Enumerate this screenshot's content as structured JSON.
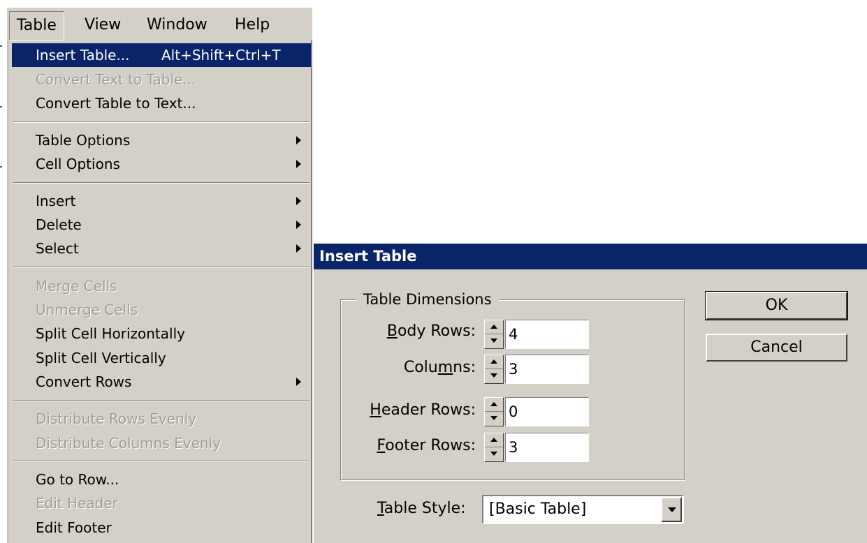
{
  "menubar": {
    "items": [
      {
        "label": "Table",
        "active": true
      },
      {
        "label": "View",
        "active": false
      },
      {
        "label": "Window",
        "active": false
      },
      {
        "label": "Help",
        "active": false
      }
    ]
  },
  "table_menu": {
    "insert_table": {
      "label": "Insert Table...",
      "shortcut": "Alt+Shift+Ctrl+T"
    },
    "convert_text_to_table": "Convert Text to Table...",
    "convert_table_to_text": "Convert Table to Text...",
    "table_options": "Table Options",
    "cell_options": "Cell Options",
    "insert": "Insert",
    "delete": "Delete",
    "select": "Select",
    "merge_cells": "Merge Cells",
    "unmerge_cells": "Unmerge Cells",
    "split_cell_horizontally": "Split Cell Horizontally",
    "split_cell_vertically": "Split Cell Vertically",
    "convert_rows": "Convert Rows",
    "distribute_rows_evenly": "Distribute Rows Evenly",
    "distribute_columns_evenly": "Distribute Columns Evenly",
    "go_to_row": "Go to Row...",
    "edit_header": "Edit Header",
    "edit_footer": "Edit Footer"
  },
  "dialog": {
    "title": "Insert Table",
    "group_label": "Table Dimensions",
    "body_rows": {
      "label_pre": "",
      "label_ul": "B",
      "label_post": "ody Rows:",
      "value": "4"
    },
    "columns": {
      "label_pre": "Colu",
      "label_ul": "m",
      "label_post": "ns:",
      "value": "3"
    },
    "header_rows": {
      "label_pre": "",
      "label_ul": "H",
      "label_post": "eader Rows:",
      "value": "0"
    },
    "footer_rows": {
      "label_pre": "",
      "label_ul": "F",
      "label_post": "ooter Rows:",
      "value": "3"
    },
    "table_style": {
      "label_pre": "",
      "label_ul": "T",
      "label_post": "able Style:",
      "value": "[Basic Table]"
    },
    "ok_label": "OK",
    "cancel_label": "Cancel"
  },
  "colors": {
    "face": "#d4d0c8",
    "titlebar": "#0a246a",
    "highlight": "#0a246a",
    "disabled_text": "#a19d95"
  }
}
